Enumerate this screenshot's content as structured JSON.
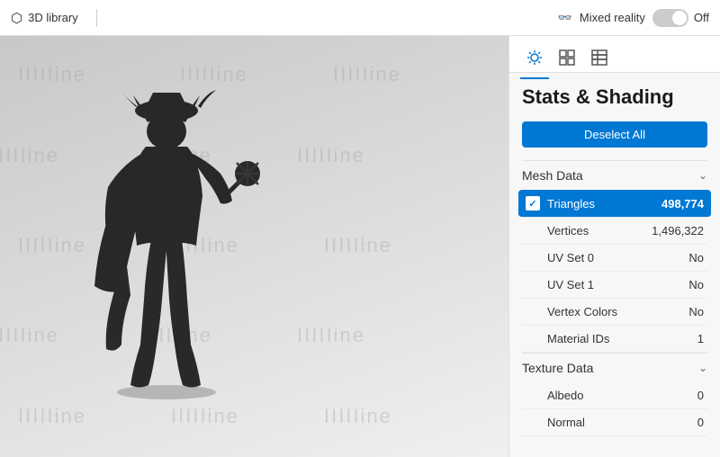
{
  "topbar": {
    "library_label": "3D library",
    "mixed_reality_label": "Mixed reality",
    "toggle_state": "Off",
    "library_icon": "⬡",
    "mixed_reality_icon": "⬚"
  },
  "panel": {
    "title": "Stats & Shading",
    "deselect_btn": "Deselect All",
    "tabs": [
      {
        "icon": "☀",
        "name": "shading-tab",
        "active": true
      },
      {
        "icon": "⊞",
        "name": "stats-tab",
        "active": false
      },
      {
        "icon": "⊟",
        "name": "uv-tab",
        "active": false
      }
    ],
    "sections": [
      {
        "name": "Mesh Data",
        "rows": [
          {
            "label": "Triangles",
            "value": "498,774",
            "highlighted": true,
            "checked": true
          },
          {
            "label": "Vertices",
            "value": "1,496,322",
            "highlighted": false,
            "checked": false
          },
          {
            "label": "UV Set 0",
            "value": "No",
            "highlighted": false,
            "checked": false
          },
          {
            "label": "UV Set 1",
            "value": "No",
            "highlighted": false,
            "checked": false
          },
          {
            "label": "Vertex Colors",
            "value": "No",
            "highlighted": false,
            "checked": false
          },
          {
            "label": "Material IDs",
            "value": "1",
            "highlighted": false,
            "checked": false
          }
        ]
      },
      {
        "name": "Texture Data",
        "rows": [
          {
            "label": "Albedo",
            "value": "0",
            "highlighted": false,
            "checked": false
          },
          {
            "label": "Normal",
            "value": "0",
            "highlighted": false,
            "checked": false
          }
        ]
      }
    ]
  },
  "watermarks": [
    "IIIIIine",
    "IIIIIine",
    "IIIIIine",
    "IIIIIine",
    "IIIIIine",
    "IIIIIine",
    "IIIIIine",
    "IIIIIine",
    "IIIIIine",
    "IIIIIine",
    "IIIIIine",
    "IIIIIine",
    "IIIIIine",
    "IIIIIine",
    "IIIIIine"
  ]
}
